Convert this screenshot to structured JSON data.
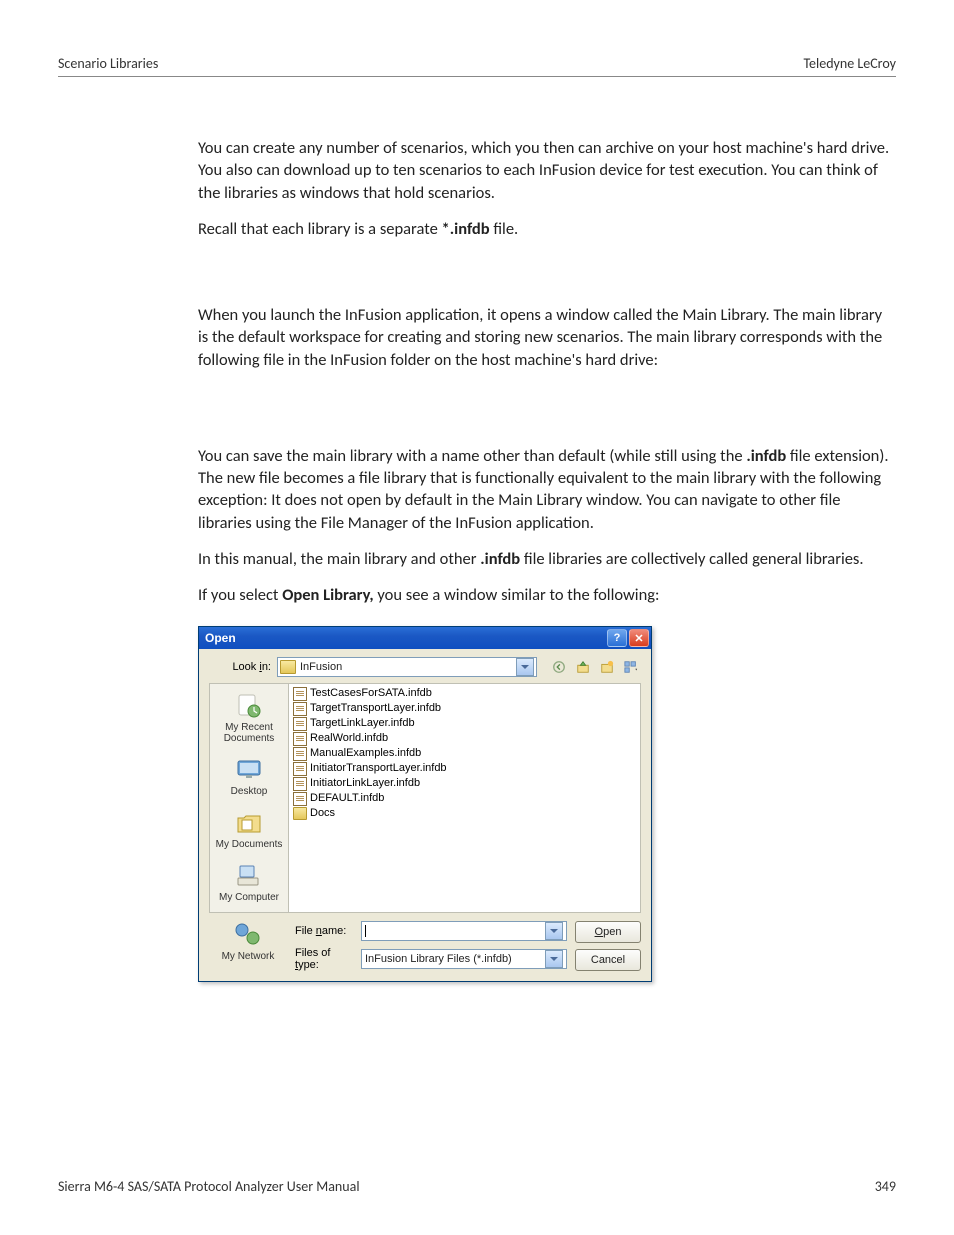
{
  "header": {
    "left": "Scenario Libraries",
    "right": "Teledyne LeCroy"
  },
  "paragraphs": {
    "p1": "You can create any number of scenarios, which you then can archive on your host machine's hard drive. You also can download up to ten scenarios to each InFusion device for test execution. You can think of the libraries as windows that hold scenarios.",
    "p2_pre": "Recall that each library is a separate ",
    "p2_bold": "*.infdb",
    "p2_post": " file.",
    "p3": "When you launch the InFusion application, it opens a window called the Main Library. The main library is the default workspace for creating and storing new scenarios. The main library corresponds with the following file in the InFusion folder on the host machine's hard drive:",
    "p4_pre": "You can save the main library with a name other than default (while still using the ",
    "p4_bold": ".infdb",
    "p4_post": " file extension). The new file becomes a file library that is functionally equivalent to the main library with the following exception: It does not open by default in the Main Library window. You can navigate to other file libraries using the File Manager of the InFusion application.",
    "p5_pre": "In this manual, the main library and other ",
    "p5_bold": ".infdb",
    "p5_post": " file libraries are collectively called general libraries.",
    "p6_pre": "If you select ",
    "p6_bold": "Open Library,",
    "p6_post": " you see a window similar to the following:"
  },
  "dialog": {
    "title": "Open",
    "lookin_label": "Look in:",
    "lookin_value": "InFusion",
    "places": {
      "recent": "My Recent Documents",
      "desktop": "Desktop",
      "mydocs": "My Documents",
      "mycomp": "My Computer",
      "mynet": "My Network"
    },
    "files": [
      "TestCasesForSATA.infdb",
      "TargetTransportLayer.infdb",
      "TargetLinkLayer.infdb",
      "RealWorld.infdb",
      "ManualExamples.infdb",
      "InitiatorTransportLayer.infdb",
      "InitiatorLinkLayer.infdb",
      "DEFAULT.infdb"
    ],
    "folder_item": "Docs",
    "filename_label": "File name:",
    "filename_value": "",
    "filetype_label": "Files of type:",
    "filetype_value": "InFusion Library Files (*.infdb)",
    "open_btn": "Open",
    "cancel_btn": "Cancel"
  },
  "footer": {
    "left": "Sierra M6-4 SAS/SATA Protocol Analyzer User Manual",
    "page": "349"
  }
}
